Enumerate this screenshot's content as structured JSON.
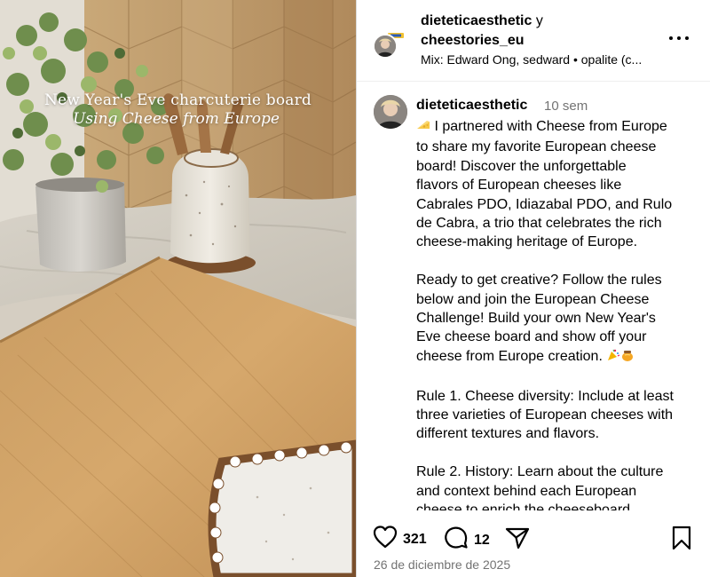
{
  "media": {
    "overlay_line1": "New Year's Eve charcuterie board",
    "overlay_line2": "Using Cheese from Europe"
  },
  "header": {
    "user1": "dieteticaesthetic",
    "conjunction": "y",
    "user2": "cheestories_eu",
    "audio": "Mix: Edward Ong, sedward • opalite (c..."
  },
  "caption": {
    "username": "dieteticaesthetic",
    "time": "10 sem",
    "lines": [
      "I partnered with Cheese from Europe",
      "to share my favorite European cheese",
      "board! Discover the unforgettable",
      "flavors of European cheeses like",
      "Cabrales PDO, Idiazabal PDO, and Rulo",
      "de Cabra, a trio that celebrates the rich",
      "cheese-making heritage of Europe.",
      "",
      "Ready to get creative? Follow the rules",
      "below and join the European Cheese",
      "Challenge! Build your own New Year's",
      "Eve cheese board and show off your",
      "cheese from Europe creation.",
      "",
      "Rule 1. Cheese diversity: Include at least",
      "three varieties of European cheeses with",
      "different textures and flavors.",
      "",
      "Rule 2. History: Learn about the culture",
      "and context behind each European",
      "cheese to enrich the cheeseboard"
    ]
  },
  "actions": {
    "likes": "321",
    "comments": "12",
    "date": "26 de diciembre de 2025"
  },
  "icons": {
    "cheese": "cheese-emoji",
    "party": "party-popper-emoji",
    "honey": "honey-pot-emoji",
    "like": "heart-icon",
    "comment": "comment-bubble-icon",
    "share": "paper-plane-icon",
    "save": "bookmark-icon",
    "more": "more-options-icon"
  }
}
